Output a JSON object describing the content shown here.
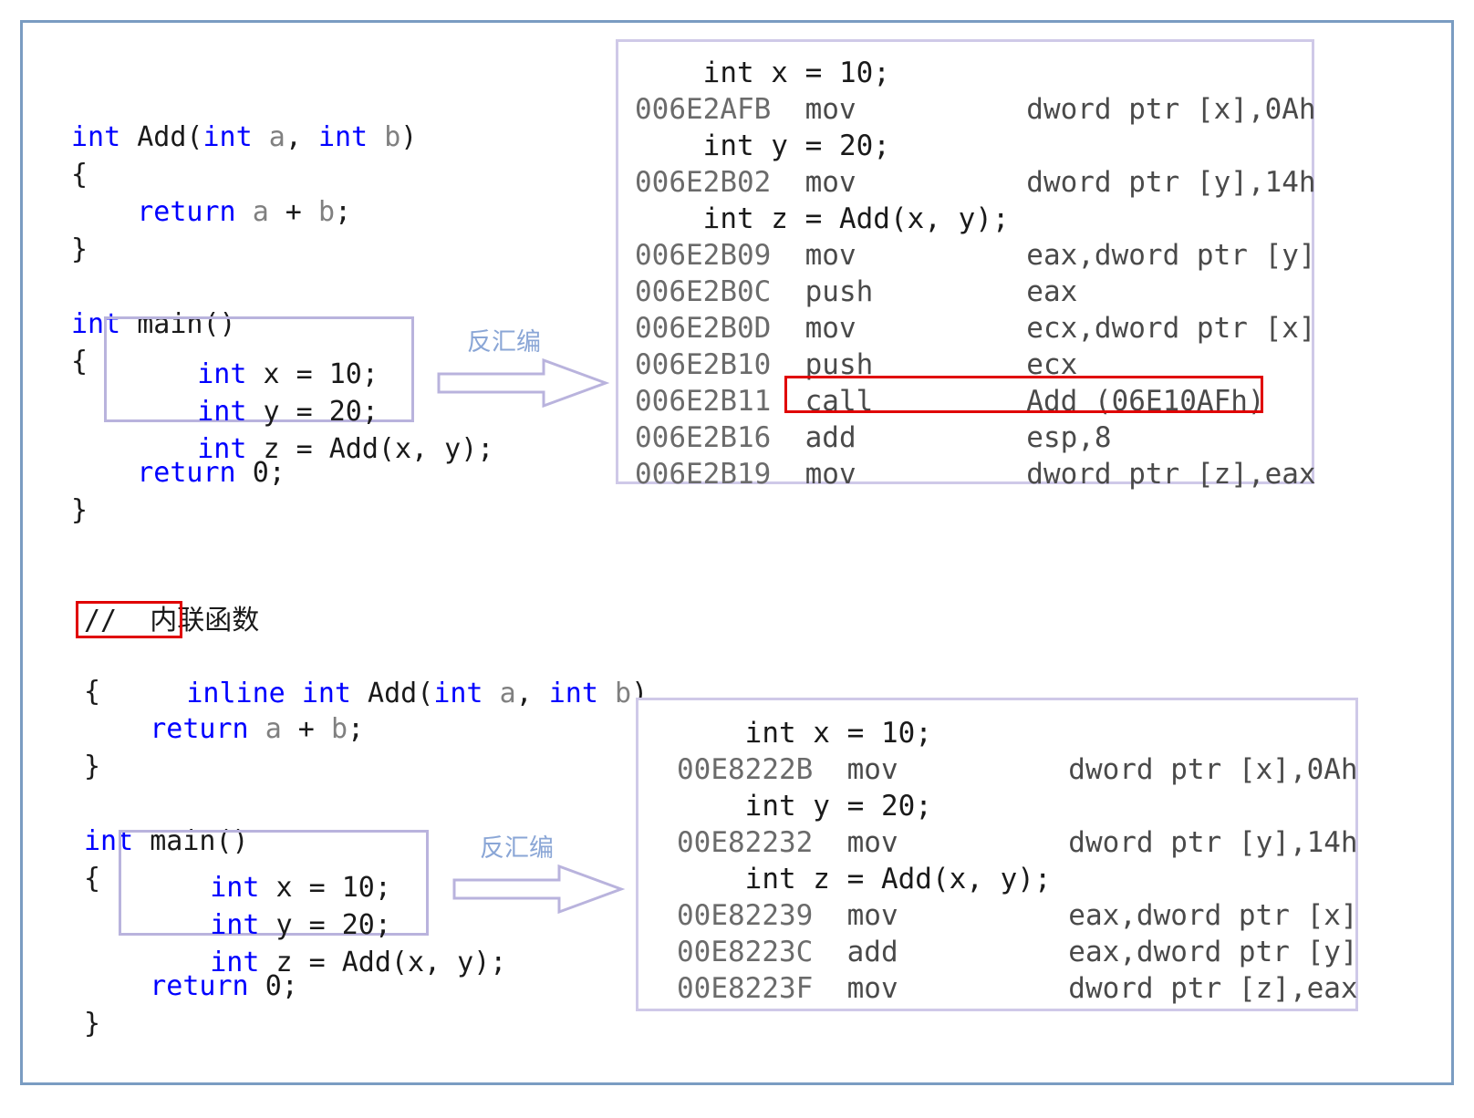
{
  "figure": {
    "title_colors": {
      "frame": "#7a9cc2",
      "highlight_box": "#b9b3dd",
      "asm_panel_border": "#cfc9e8",
      "red_emphasis": "#e00000",
      "keyword": "#0000ff",
      "comment": "#008000",
      "param": "#808080",
      "arrow": "#b9b3dd",
      "arrow_label": "#8aa6d6"
    }
  },
  "arrows": {
    "top": {
      "label": "反汇编"
    },
    "bottom": {
      "label": "反汇编"
    }
  },
  "top_example": {
    "source_lines": [
      {
        "segments": [
          {
            "t": "int",
            "c": "kw"
          },
          {
            "t": " Add(",
            "c": "ident"
          },
          {
            "t": "int",
            "c": "kw"
          },
          {
            "t": " ",
            "c": "ident"
          },
          {
            "t": "a",
            "c": "param"
          },
          {
            "t": ", ",
            "c": "ident"
          },
          {
            "t": "int",
            "c": "kw"
          },
          {
            "t": " ",
            "c": "ident"
          },
          {
            "t": "b",
            "c": "param"
          },
          {
            "t": ")",
            "c": "ident"
          }
        ]
      },
      {
        "segments": [
          {
            "t": "{",
            "c": "ident"
          }
        ]
      },
      {
        "segments": [
          {
            "t": "    ",
            "c": "ident"
          },
          {
            "t": "return",
            "c": "kw"
          },
          {
            "t": " ",
            "c": "ident"
          },
          {
            "t": "a",
            "c": "param"
          },
          {
            "t": " + ",
            "c": "ident"
          },
          {
            "t": "b",
            "c": "param"
          },
          {
            "t": ";",
            "c": "ident"
          }
        ]
      },
      {
        "segments": [
          {
            "t": "}",
            "c": "ident"
          }
        ]
      },
      {
        "segments": [
          {
            "t": " ",
            "c": "ident"
          }
        ]
      },
      {
        "segments": [
          {
            "t": "int",
            "c": "kw"
          },
          {
            "t": " main()",
            "c": "ident"
          }
        ]
      },
      {
        "segments": [
          {
            "t": "{",
            "c": "ident"
          }
        ]
      }
    ],
    "boxed_lines": [
      {
        "segments": [
          {
            "t": "    ",
            "c": "ident"
          },
          {
            "t": "int",
            "c": "kw"
          },
          {
            "t": " x = ",
            "c": "ident"
          },
          {
            "t": "10",
            "c": "ident"
          },
          {
            "t": ";",
            "c": "ident"
          }
        ]
      },
      {
        "segments": [
          {
            "t": "    ",
            "c": "ident"
          },
          {
            "t": "int",
            "c": "kw"
          },
          {
            "t": " y = ",
            "c": "ident"
          },
          {
            "t": "20",
            "c": "ident"
          },
          {
            "t": ";",
            "c": "ident"
          }
        ]
      },
      {
        "segments": [
          {
            "t": "    ",
            "c": "ident"
          },
          {
            "t": "int",
            "c": "kw"
          },
          {
            "t": " z = Add(x, y);",
            "c": "ident"
          }
        ]
      }
    ],
    "tail_lines": [
      {
        "segments": [
          {
            "t": "    ",
            "c": "ident"
          },
          {
            "t": "return",
            "c": "kw"
          },
          {
            "t": " ",
            "c": "ident"
          },
          {
            "t": "0",
            "c": "ident"
          },
          {
            "t": ";",
            "c": "ident"
          }
        ]
      },
      {
        "segments": [
          {
            "t": "}",
            "c": "ident"
          }
        ]
      }
    ]
  },
  "top_disassembly": {
    "lines": [
      {
        "kind": "src",
        "text": "    int x = 10;"
      },
      {
        "kind": "asm",
        "addr": "006E2AFB",
        "mnemonic": "mov",
        "operands": "dword ptr [x],0Ah"
      },
      {
        "kind": "src",
        "text": "    int y = 20;"
      },
      {
        "kind": "asm",
        "addr": "006E2B02",
        "mnemonic": "mov",
        "operands": "dword ptr [y],14h"
      },
      {
        "kind": "src",
        "text": "    int z = Add(x, y);"
      },
      {
        "kind": "asm",
        "addr": "006E2B09",
        "mnemonic": "mov",
        "operands": "eax,dword ptr [y]"
      },
      {
        "kind": "asm",
        "addr": "006E2B0C",
        "mnemonic": "push",
        "operands": "eax"
      },
      {
        "kind": "asm",
        "addr": "006E2B0D",
        "mnemonic": "mov",
        "operands": "ecx,dword ptr [x]"
      },
      {
        "kind": "asm",
        "addr": "006E2B10",
        "mnemonic": "push",
        "operands": "ecx"
      },
      {
        "kind": "asm",
        "addr": "006E2B11",
        "mnemonic": "call",
        "operands": "Add (06E10AFh)",
        "highlighted": true
      },
      {
        "kind": "asm",
        "addr": "006E2B16",
        "mnemonic": "add",
        "operands": "esp,8"
      },
      {
        "kind": "asm",
        "addr": "006E2B19",
        "mnemonic": "mov",
        "operands": "dword ptr [z],eax"
      }
    ]
  },
  "bottom_example": {
    "comment_line": "//  内联函数",
    "inline_keyword": "inline",
    "signature_rest": [
      {
        "t": " ",
        "c": "ident"
      },
      {
        "t": "int",
        "c": "kw"
      },
      {
        "t": " Add(",
        "c": "ident"
      },
      {
        "t": "int",
        "c": "kw"
      },
      {
        "t": " ",
        "c": "ident"
      },
      {
        "t": "a",
        "c": "param"
      },
      {
        "t": ", ",
        "c": "ident"
      },
      {
        "t": "int",
        "c": "kw"
      },
      {
        "t": " ",
        "c": "ident"
      },
      {
        "t": "b",
        "c": "param"
      },
      {
        "t": ")",
        "c": "ident"
      }
    ],
    "body_lines": [
      {
        "segments": [
          {
            "t": "{",
            "c": "ident"
          }
        ]
      },
      {
        "segments": [
          {
            "t": "    ",
            "c": "ident"
          },
          {
            "t": "return",
            "c": "kw"
          },
          {
            "t": " ",
            "c": "ident"
          },
          {
            "t": "a",
            "c": "param"
          },
          {
            "t": " + ",
            "c": "ident"
          },
          {
            "t": "b",
            "c": "param"
          },
          {
            "t": ";",
            "c": "ident"
          }
        ]
      },
      {
        "segments": [
          {
            "t": "}",
            "c": "ident"
          }
        ]
      },
      {
        "segments": [
          {
            "t": " ",
            "c": "ident"
          }
        ]
      },
      {
        "segments": [
          {
            "t": "int",
            "c": "kw"
          },
          {
            "t": " main()",
            "c": "ident"
          }
        ]
      },
      {
        "segments": [
          {
            "t": "{",
            "c": "ident"
          }
        ]
      }
    ],
    "boxed_lines": [
      {
        "segments": [
          {
            "t": "    ",
            "c": "ident"
          },
          {
            "t": "int",
            "c": "kw"
          },
          {
            "t": " x = ",
            "c": "ident"
          },
          {
            "t": "10",
            "c": "ident"
          },
          {
            "t": ";",
            "c": "ident"
          }
        ]
      },
      {
        "segments": [
          {
            "t": "    ",
            "c": "ident"
          },
          {
            "t": "int",
            "c": "kw"
          },
          {
            "t": " y = ",
            "c": "ident"
          },
          {
            "t": "20",
            "c": "ident"
          },
          {
            "t": ";",
            "c": "ident"
          }
        ]
      },
      {
        "segments": [
          {
            "t": "    ",
            "c": "ident"
          },
          {
            "t": "int",
            "c": "kw"
          },
          {
            "t": " z = Add(x, y);",
            "c": "ident"
          }
        ]
      }
    ],
    "tail_lines": [
      {
        "segments": [
          {
            "t": "    ",
            "c": "ident"
          },
          {
            "t": "return",
            "c": "kw"
          },
          {
            "t": " ",
            "c": "ident"
          },
          {
            "t": "0",
            "c": "ident"
          },
          {
            "t": ";",
            "c": "ident"
          }
        ]
      },
      {
        "segments": [
          {
            "t": "}",
            "c": "ident"
          }
        ]
      }
    ]
  },
  "bottom_disassembly": {
    "lines": [
      {
        "kind": "src",
        "text": "    int x = 10;"
      },
      {
        "kind": "asm",
        "addr": "00E8222B",
        "mnemonic": "mov",
        "operands": "dword ptr [x],0Ah"
      },
      {
        "kind": "src",
        "text": "    int y = 20;"
      },
      {
        "kind": "asm",
        "addr": "00E82232",
        "mnemonic": "mov",
        "operands": "dword ptr [y],14h"
      },
      {
        "kind": "src",
        "text": "    int z = Add(x, y);"
      },
      {
        "kind": "asm",
        "addr": "00E82239",
        "mnemonic": "mov",
        "operands": "eax,dword ptr [x]"
      },
      {
        "kind": "asm",
        "addr": "00E8223C",
        "mnemonic": "add",
        "operands": "eax,dword ptr [y]"
      },
      {
        "kind": "asm",
        "addr": "00E8223F",
        "mnemonic": "mov",
        "operands": "dword ptr [z],eax"
      }
    ]
  }
}
